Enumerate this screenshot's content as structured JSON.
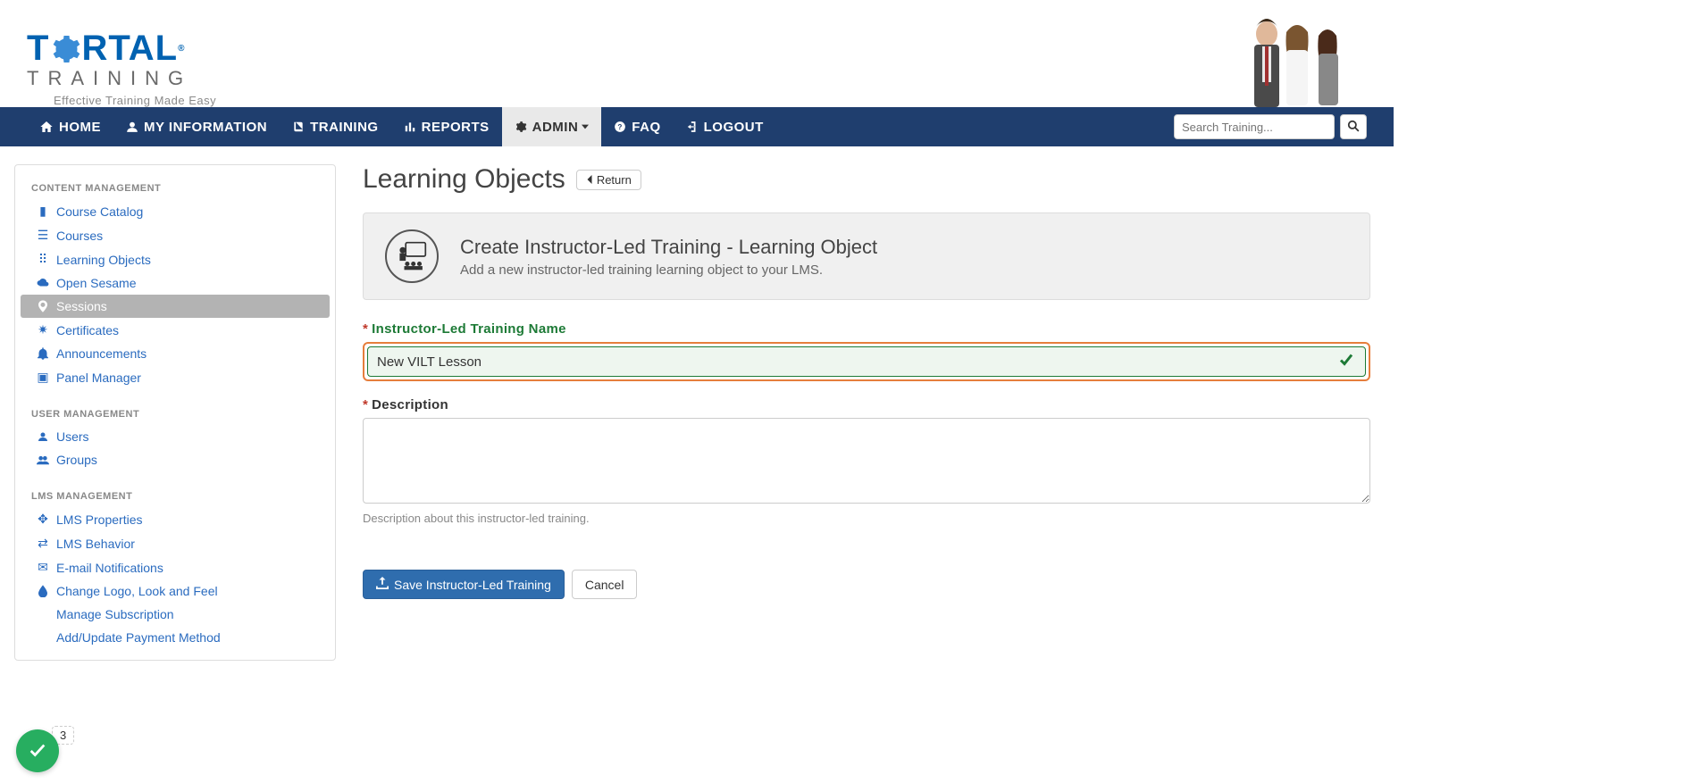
{
  "logo": {
    "brand1": "T",
    "brand2": "RTAL",
    "subline": "TRAINING",
    "tagline": "Effective Training Made Easy",
    "reg": "®"
  },
  "nav": {
    "home": "HOME",
    "my_info": "MY INFORMATION",
    "training": "TRAINING",
    "reports": "REPORTS",
    "admin": "ADMIN",
    "faq": "FAQ",
    "logout": "LOGOUT",
    "search_placeholder": "Search Training..."
  },
  "sidebar": {
    "section1": "CONTENT MANAGEMENT",
    "s1_items": [
      "Course Catalog",
      "Courses",
      "Learning Objects",
      "Open Sesame",
      "Sessions",
      "Certificates",
      "Announcements",
      "Panel Manager"
    ],
    "section2": "USER MANAGEMENT",
    "s2_items": [
      "Users",
      "Groups"
    ],
    "section3": "LMS MANAGEMENT",
    "s3_items": [
      "LMS Properties",
      "LMS Behavior",
      "E-mail Notifications",
      "Change Logo, Look and Feel",
      "Manage Subscription",
      "Add/Update Payment Method"
    ]
  },
  "main": {
    "heading": "Learning Objects",
    "return": "Return",
    "panel_title": "Create Instructor-Led Training - Learning Object",
    "panel_sub": "Add a new instructor-led training learning object to your LMS.",
    "name_label": "Instructor-Led Training Name",
    "name_value": "New VILT Lesson",
    "desc_label": "Description",
    "desc_help": "Description about this instructor-led training.",
    "save_btn": "Save Instructor-Led Training",
    "cancel_btn": "Cancel"
  },
  "step": {
    "number": "3"
  }
}
